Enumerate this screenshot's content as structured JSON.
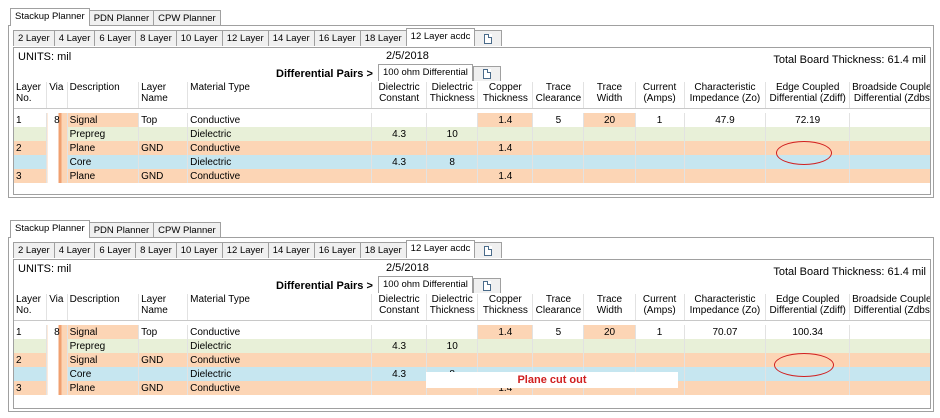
{
  "top_tabs": [
    "Stackup Planner",
    "PDN Planner",
    "CPW Planner"
  ],
  "layer_tabs": [
    "2 Layer",
    "4 Layer",
    "6 Layer",
    "8 Layer",
    "10 Layer",
    "12 Layer",
    "14 Layer",
    "16 Layer",
    "18 Layer",
    "12 Layer acdc"
  ],
  "units": "UNITS: mil",
  "date": "2/5/2018",
  "total_thickness": "Total Board Thickness: 61.4 mil",
  "diff_pairs_label": "Differential Pairs >",
  "diff_pairs_tab": "100 ohm Differential",
  "columns": [
    "Layer No.",
    "Via",
    "Description",
    "Layer Name",
    "Material Type",
    "Dielectric Constant",
    "Dielectric Thickness",
    "Copper Thickness",
    "Trace Clearance",
    "Trace Width",
    "Current (Amps)",
    "Characteristic Impedance (Zo)",
    "Edge Coupled Differential (Zdiff)",
    "Broadside Coupled Differential (Zdbs)"
  ],
  "col_lines": [
    [
      "Layer",
      "No."
    ],
    [
      "Via",
      ""
    ],
    [
      "Description",
      ""
    ],
    [
      "Layer",
      "Name"
    ],
    [
      "Material Type",
      ""
    ],
    [
      "Dielectric",
      "Constant"
    ],
    [
      "Dielectric",
      "Thickness"
    ],
    [
      "Copper",
      "Thickness"
    ],
    [
      "Trace",
      "Clearance"
    ],
    [
      "Trace",
      "Width"
    ],
    [
      "Current",
      "(Amps)"
    ],
    [
      "Characteristic",
      "Impedance (Zo)"
    ],
    [
      "Edge Coupled",
      "Differential (Zdiff)"
    ],
    [
      "Broadside Coupled",
      "Differential (Zdbs)"
    ]
  ],
  "panel1": {
    "rows": [
      {
        "style": "white",
        "layer": "1",
        "via": "8",
        "desc": "Signal",
        "name": "Top",
        "material": "Conductive",
        "dk": "",
        "dt": "",
        "cu": "1.4",
        "clear": "5",
        "width": "20",
        "amps": "1",
        "zo": "47.9",
        "zdiff": "72.19",
        "zdbs": ""
      },
      {
        "style": "green",
        "layer": "",
        "via": "",
        "desc": "Prepreg",
        "name": "",
        "material": "Dielectric",
        "dk": "4.3",
        "dt": "10",
        "cu": "",
        "clear": "",
        "width": "",
        "amps": "",
        "zo": "",
        "zdiff": "",
        "zdbs": ""
      },
      {
        "style": "orange",
        "layer": "2",
        "via": "",
        "desc": "Plane",
        "name": "GND",
        "material": "Conductive",
        "dk": "",
        "dt": "",
        "cu": "1.4",
        "clear": "",
        "width": "",
        "amps": "",
        "zo": "",
        "zdiff": "",
        "zdbs": ""
      },
      {
        "style": "blue",
        "layer": "",
        "via": "",
        "desc": "Core",
        "name": "",
        "material": "Dielectric",
        "dk": "4.3",
        "dt": "8",
        "cu": "",
        "clear": "",
        "width": "",
        "amps": "",
        "zo": "",
        "zdiff": "",
        "zdbs": ""
      },
      {
        "style": "orange",
        "layer": "3",
        "via": "",
        "desc": "Plane",
        "name": "GND",
        "material": "Conductive",
        "dk": "",
        "dt": "",
        "cu": "1.4",
        "clear": "",
        "width": "",
        "amps": "",
        "zo": "",
        "zdiff": "",
        "zdbs": ""
      }
    ]
  },
  "panel2": {
    "rows": [
      {
        "style": "white",
        "layer": "1",
        "via": "8",
        "desc": "Signal",
        "name": "Top",
        "material": "Conductive",
        "dk": "",
        "dt": "",
        "cu": "1.4",
        "clear": "5",
        "width": "20",
        "amps": "1",
        "zo": "70.07",
        "zdiff": "100.34",
        "zdbs": ""
      },
      {
        "style": "green",
        "layer": "",
        "via": "",
        "desc": "Prepreg",
        "name": "",
        "material": "Dielectric",
        "dk": "4.3",
        "dt": "10",
        "cu": "",
        "clear": "",
        "width": "",
        "amps": "",
        "zo": "",
        "zdiff": "",
        "zdbs": ""
      },
      {
        "style": "orange",
        "layer": "2",
        "via": "",
        "desc": "Signal",
        "name": "GND",
        "material": "Conductive",
        "dk": "",
        "dt": "",
        "cu": "",
        "clear": "",
        "width": "",
        "amps": "",
        "zo": "",
        "zdiff": "",
        "zdbs": ""
      },
      {
        "style": "blue",
        "layer": "",
        "via": "",
        "desc": "Core",
        "name": "",
        "material": "Dielectric",
        "dk": "4.3",
        "dt": "8",
        "cu": "",
        "clear": "",
        "width": "",
        "amps": "",
        "zo": "",
        "zdiff": "",
        "zdbs": ""
      },
      {
        "style": "orange",
        "layer": "3",
        "via": "",
        "desc": "Plane",
        "name": "GND",
        "material": "Conductive",
        "dk": "",
        "dt": "",
        "cu": "1.4",
        "clear": "",
        "width": "",
        "amps": "",
        "zo": "",
        "zdiff": "",
        "zdbs": ""
      }
    ],
    "annotation": "Plane cut out"
  },
  "colors": {
    "orange": "#fcd5b5",
    "green": "#e8f0d8",
    "blue": "#c6e6f0",
    "annotation": "#d02020"
  }
}
